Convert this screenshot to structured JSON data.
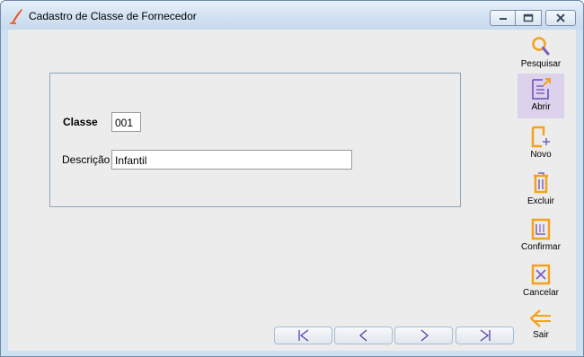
{
  "window": {
    "title": "Cadastro de Classe de Fornecedor"
  },
  "form": {
    "classe_label": "Classe",
    "classe_value": "001",
    "descricao_label": "Descrição",
    "descricao_value": "Infantil"
  },
  "toolbar": {
    "pesquisar": "Pesquisar",
    "abrir": "Abrir",
    "novo": "Novo",
    "excluir": "Excluir",
    "confirmar": "Confirmar",
    "cancelar": "Cancelar",
    "sair": "Sair"
  },
  "icons": {
    "pesquisar": "search-icon",
    "abrir": "open-document-icon",
    "novo": "new-document-icon",
    "excluir": "trash-icon",
    "confirmar": "confirm-document-icon",
    "cancelar": "cancel-icon",
    "sair": "exit-arrow-icon",
    "first": "first-record-icon",
    "prev": "previous-record-icon",
    "next": "next-record-icon",
    "last": "last-record-icon"
  },
  "colors": {
    "icon_orange": "#f5a21b",
    "icon_purple": "#7a5fc0",
    "active_tool_bg": "#ddd2ec",
    "client_bg": "#ececec",
    "title_bar": "#d3e2f2"
  }
}
